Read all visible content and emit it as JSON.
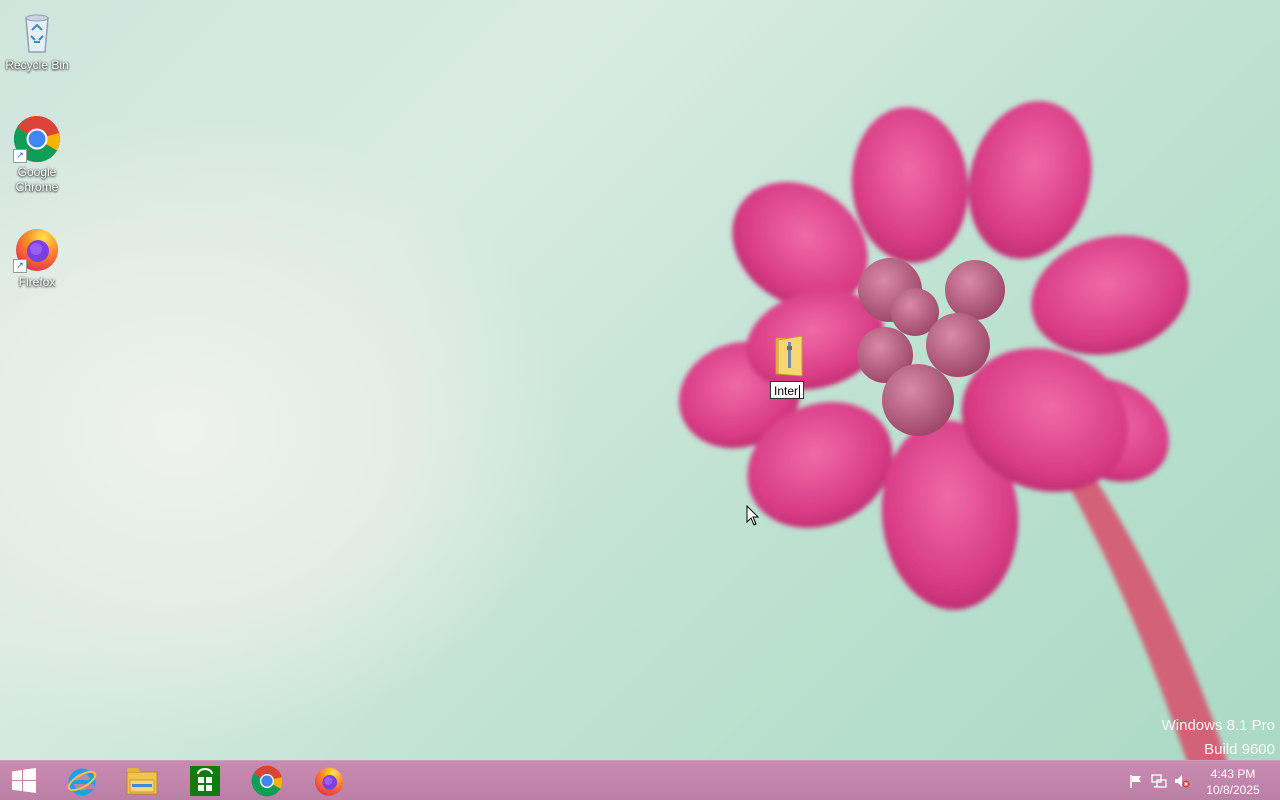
{
  "desktop": {
    "icons": [
      {
        "label": "Recycle Bin",
        "icon": "recycle-bin-icon"
      },
      {
        "label": "Google Chrome",
        "icon": "chrome-icon"
      },
      {
        "label": "Firefox",
        "icon": "firefox-icon"
      }
    ],
    "renaming_item": {
      "icon": "folder-icon",
      "edit_value": "Inter"
    }
  },
  "watermark": {
    "line1": "Windows 8.1 Pro",
    "line2": "Build 9600"
  },
  "taskbar": {
    "start": "windows-start-icon",
    "pinned": [
      {
        "icon": "internet-explorer-icon"
      },
      {
        "icon": "file-explorer-icon"
      },
      {
        "icon": "store-icon"
      },
      {
        "icon": "chrome-icon"
      },
      {
        "icon": "firefox-icon"
      }
    ],
    "tray": {
      "icons": [
        "action-center-flag-icon",
        "network-icon",
        "volume-muted-icon"
      ],
      "time": "4:43 PM",
      "date": "10/8/2025"
    }
  },
  "colors": {
    "taskbar": "#c98bb0",
    "wallpaper_bg": "#bfe2d2",
    "flower": "#e0458f"
  }
}
